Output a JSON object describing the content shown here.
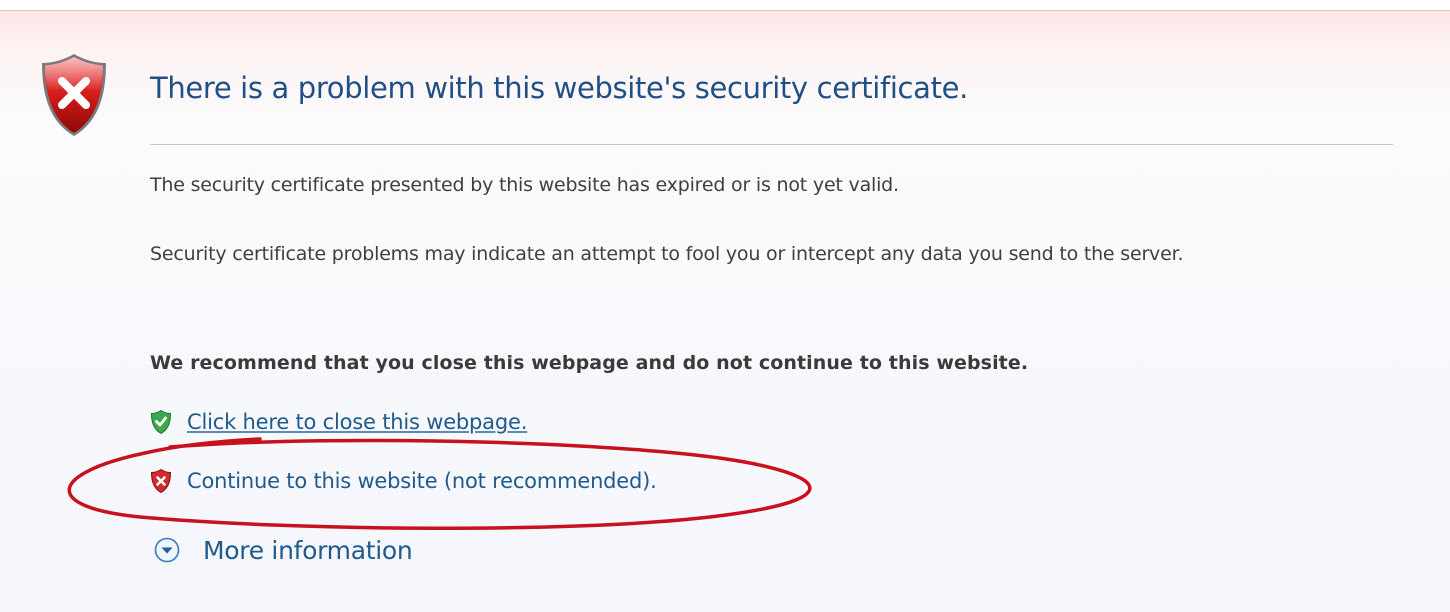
{
  "page": {
    "title": "There is a problem with this website's security certificate.",
    "message_expired": "The security certificate presented by this website has expired or is not yet valid.",
    "message_warning": "Security certificate problems may indicate an attempt to fool you or intercept any data you send to the server.",
    "recommendation": "We recommend that you close this webpage and do not continue to this website."
  },
  "links": {
    "close": {
      "label": "Click here to close this webpage.",
      "icon": "green-shield-check-icon"
    },
    "continue": {
      "label": "Continue to this website (not recommended).",
      "icon": "red-shield-x-icon"
    },
    "more_info": {
      "label": "More information",
      "icon": "chevron-down-circle-icon"
    }
  },
  "icons": {
    "main": "red-shield-error-icon"
  },
  "colors": {
    "title": "#1f4f86",
    "link": "#1f5a8d",
    "body_text": "#3f3f3f",
    "annotation": "#c8101e",
    "header_tint": "#fde3e3"
  }
}
